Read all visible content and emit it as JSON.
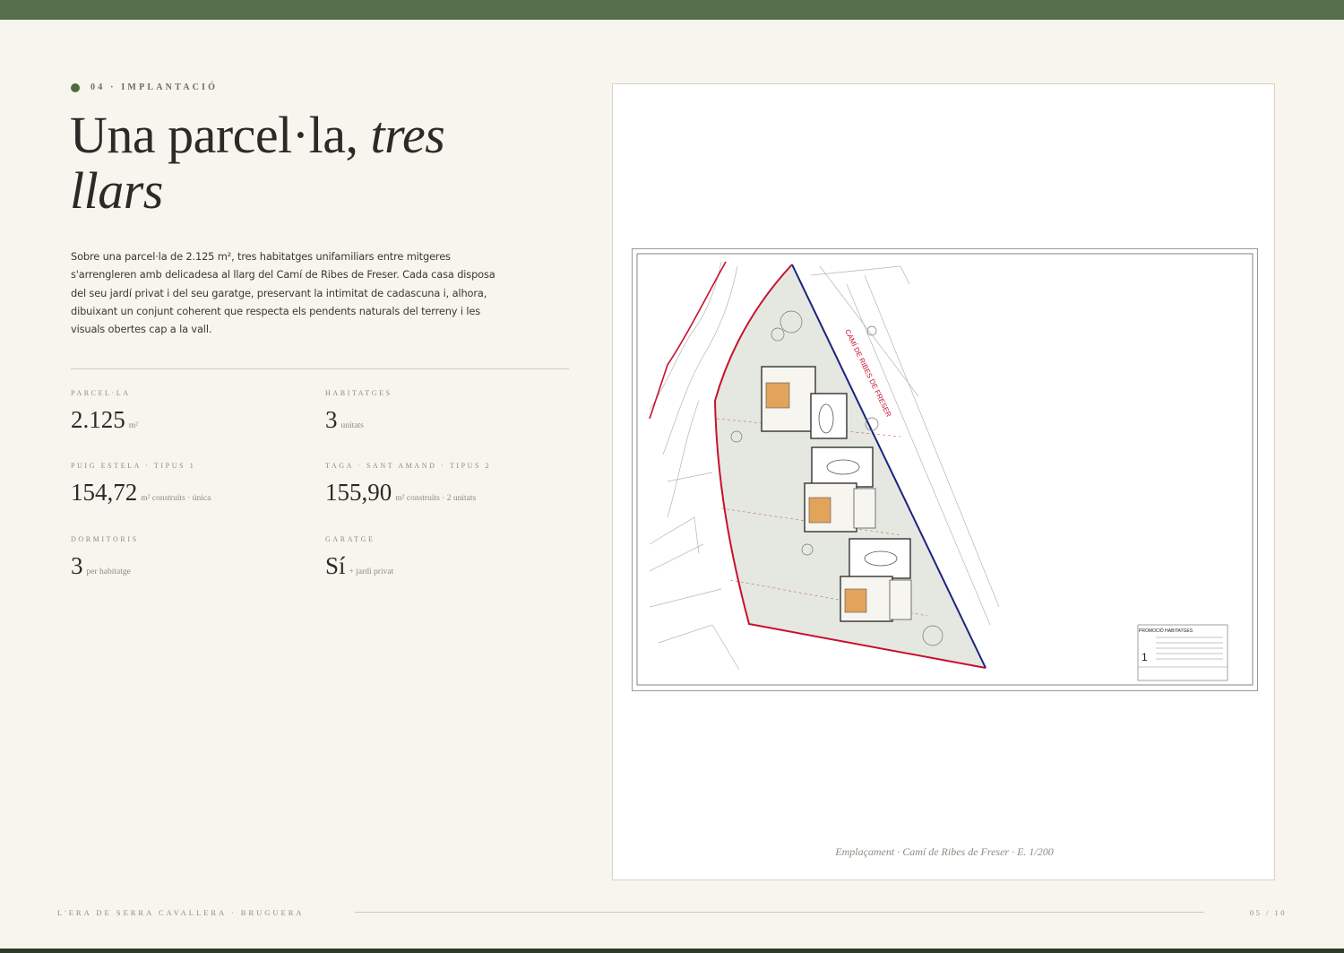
{
  "header": {
    "eyebrow": "04 · IMPLANTACIÓ",
    "title_regular": "Una parcel·la, ",
    "title_italic_1": "tres",
    "title_italic_2": "llars"
  },
  "intro": "Sobre una parcel·la de 2.125 m², tres habitatges unifamiliars entre mitgeres s'arrengleren amb delicadesa al llarg del Camí de Ribes de Freser. Cada casa disposa del seu jardí privat i del seu garatge, preservant la intimitat de cadascuna i, alhora, dibuixant un conjunt coherent que respecta els pendents naturals del terreny i les visuals obertes cap a la vall.",
  "stats": [
    {
      "label": "PARCEL·LA",
      "value": "2.125",
      "unit": "m²"
    },
    {
      "label": "HABITATGES",
      "value": "3",
      "unit": "unitats"
    },
    {
      "label": "PUIG ESTELA · TIPUS 1",
      "value": "154,72",
      "unit": "m² construïts · única"
    },
    {
      "label": "TAGA · SANT AMAND · TIPUS 2",
      "value": "155,90",
      "unit": "m² construïts · 2 unitats"
    },
    {
      "label": "DORMITORIS",
      "value": "3",
      "unit": "per habitatge"
    },
    {
      "label": "GARATGE",
      "value": "Sí",
      "unit": "+ jardí privat"
    }
  ],
  "plan": {
    "street_label": "CAMÍ DE RIBES DE FRESER",
    "title_block_heading": "PROMOCIÓ HABITATGES",
    "sheet_number": "1",
    "caption": "Emplaçament · Camí de Ribes de Freser · E. 1/200"
  },
  "footer": {
    "left": "L'ERA DE SERRA CAVALLERA · BRUGUERA",
    "right": "05 / 10"
  },
  "colors": {
    "top_bar": "#566e4a",
    "accent_dot": "#4f6b3e",
    "background": "#f8f5ee",
    "boundary_red": "#c8102e",
    "boundary_blue": "#1a237e"
  }
}
